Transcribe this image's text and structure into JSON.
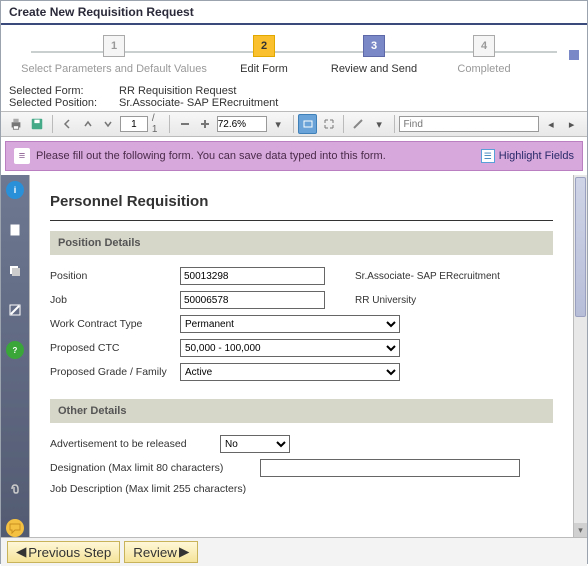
{
  "title": "Create New Requisition Request",
  "wizard": {
    "steps": [
      {
        "num": "1",
        "label": "Select Parameters and Default Values"
      },
      {
        "num": "2",
        "label": "Edit Form"
      },
      {
        "num": "3",
        "label": "Review and Send"
      },
      {
        "num": "4",
        "label": "Completed"
      }
    ]
  },
  "selected": {
    "form_label": "Selected Form:",
    "form_value": "RR Requisition Request",
    "position_label": "Selected Position:",
    "position_value": "Sr.Associate- SAP ERecruitment"
  },
  "toolbar": {
    "page_current": "1",
    "page_total": "/ 1",
    "zoom": "72.6%",
    "find_placeholder": "Find"
  },
  "notice": {
    "text": "Please fill out the following form. You can save data typed into this form.",
    "highlight": "Highlight Fields"
  },
  "form": {
    "title": "Personnel Requisition",
    "sections": {
      "position": {
        "header": "Position Details",
        "fields": {
          "position_label": "Position",
          "position_value": "50013298",
          "position_desc": "Sr.Associate- SAP ERecruitment",
          "job_label": "Job",
          "job_value": "50006578",
          "job_desc": "RR University",
          "contract_label": "Work Contract Type",
          "contract_value": "Permanent",
          "ctc_label": "Proposed CTC",
          "ctc_value": "50,000 - 100,000",
          "grade_label": "Proposed Grade / Family",
          "grade_value": "Active"
        }
      },
      "other": {
        "header": "Other Details",
        "fields": {
          "ad_label": "Advertisement to be released",
          "ad_value": "No",
          "designation_label": "Designation (Max limit 80 characters)",
          "jobdesc_label": "Job Description (Max limit 255 characters)"
        }
      }
    }
  },
  "footer": {
    "prev": "Previous Step",
    "review": "Review"
  }
}
